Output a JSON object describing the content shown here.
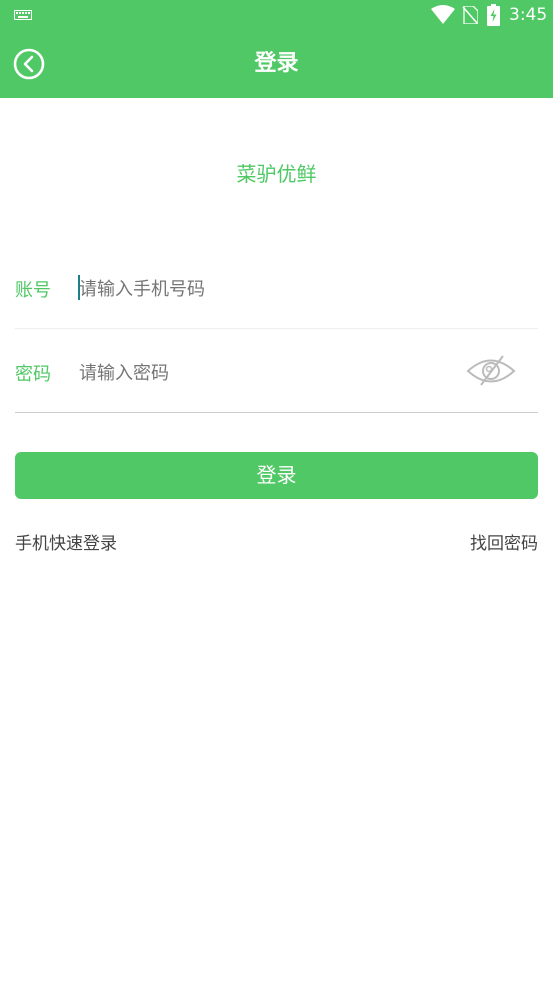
{
  "status_bar": {
    "time": "3:45",
    "icons": [
      "keyboard-icon",
      "wifi-icon",
      "no-sim-icon",
      "battery-charging-icon"
    ]
  },
  "header": {
    "title": "登录",
    "back_icon": "back-circle-icon"
  },
  "brand": {
    "name": "菜驴优鲜"
  },
  "form": {
    "account": {
      "label": "账号",
      "placeholder": "请输入手机号码",
      "value": ""
    },
    "password": {
      "label": "密码",
      "placeholder": "请输入密码",
      "value": "",
      "toggle_icon": "eye-hidden-icon"
    },
    "submit_label": "登录"
  },
  "links": {
    "quick_login": "手机快速登录",
    "forgot_password": "找回密码"
  },
  "colors": {
    "accent": "#4fc865",
    "text_secondary": "#444444",
    "placeholder": "#9a9a9a",
    "divider": "#eeeeee",
    "divider_active": "#cccccc"
  }
}
